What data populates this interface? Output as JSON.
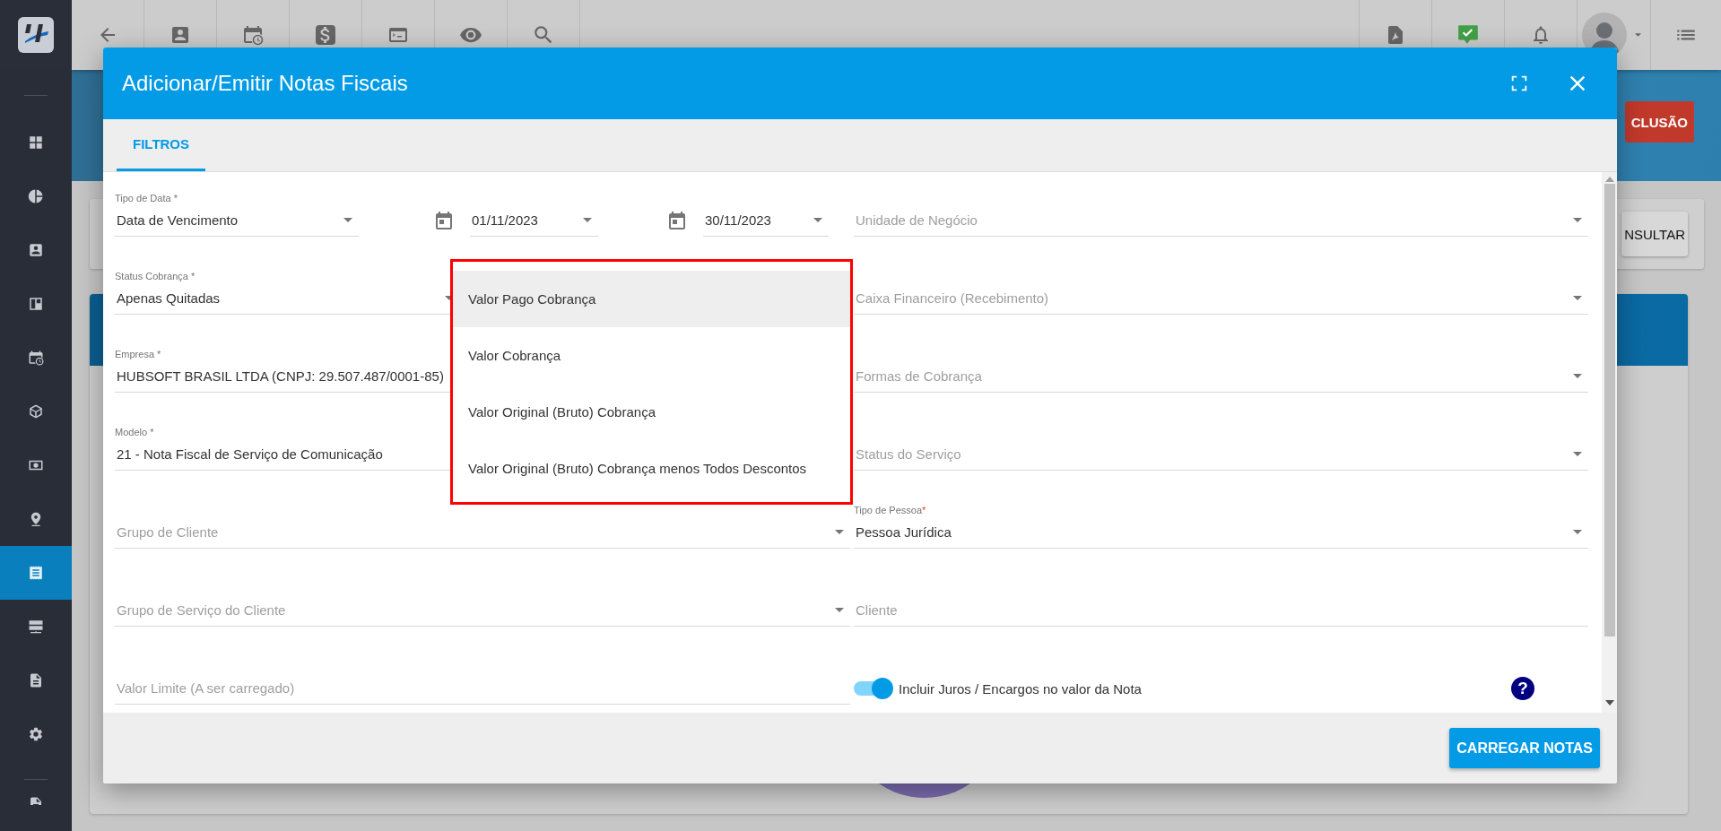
{
  "sidebar": {
    "items": [
      {
        "selected": false
      },
      {
        "selected": false
      },
      {
        "selected": false
      },
      {
        "selected": false
      },
      {
        "selected": false
      },
      {
        "selected": false
      },
      {
        "selected": false
      },
      {
        "selected": false
      },
      {
        "selected": true
      },
      {
        "selected": false
      },
      {
        "selected": false
      },
      {
        "selected": false
      }
    ]
  },
  "background": {
    "alert_button": "CLUSÃO",
    "consult_button": "NSULTAR"
  },
  "dialog": {
    "title": "Adicionar/Emitir Notas Fiscais",
    "tabs": [
      {
        "label": "FILTROS",
        "selected": true
      }
    ],
    "left_fields": [
      {
        "kind": "date_range",
        "label": "Tipo de Data *",
        "value": "Data de Vencimento",
        "start": "01/11/2023",
        "end": "30/11/2023"
      },
      {
        "kind": "select",
        "label": "Status Cobrança *",
        "value": "Apenas Quitadas"
      },
      {
        "kind": "text",
        "label": "Empresa *",
        "value": "HUBSOFT BRASIL LTDA (CNPJ: 29.507.487/0001-85)"
      },
      {
        "kind": "text",
        "label": "Modelo *",
        "value": "21 - Nota Fiscal de Serviço de Comunicação"
      },
      {
        "kind": "select",
        "placeholder": "Grupo de Cliente"
      },
      {
        "kind": "select",
        "placeholder": "Grupo de Serviço do Cliente"
      },
      {
        "kind": "text",
        "placeholder": "Valor Limite (A ser carregado)"
      }
    ],
    "right_fields": [
      {
        "kind": "select",
        "placeholder": "Unidade de Negócio"
      },
      {
        "kind": "select",
        "placeholder": "Caixa Financeiro (Recebimento)"
      },
      {
        "kind": "select",
        "placeholder": "Formas de Cobrança"
      },
      {
        "kind": "select",
        "placeholder": "Status do Serviço"
      },
      {
        "kind": "select",
        "label": "Tipo de Pessoa",
        "label_mark": "*",
        "value": "Pessoa Jurídica"
      },
      {
        "kind": "text",
        "placeholder": "Cliente"
      },
      {
        "kind": "toggle",
        "label": "Incluir Juros / Encargos no valor da Nota",
        "on": true,
        "help": "?"
      }
    ],
    "dropdown": {
      "options": [
        {
          "label": "Valor Pago Cobrança",
          "selected": true
        },
        {
          "label": "Valor Cobrança",
          "selected": false
        },
        {
          "label": "Valor Original (Bruto) Cobrança",
          "selected": false
        },
        {
          "label": "Valor Original (Bruto) Cobrança menos Todos Descontos",
          "selected": false
        }
      ]
    },
    "submit_button": "CARREGAR NOTAS"
  }
}
